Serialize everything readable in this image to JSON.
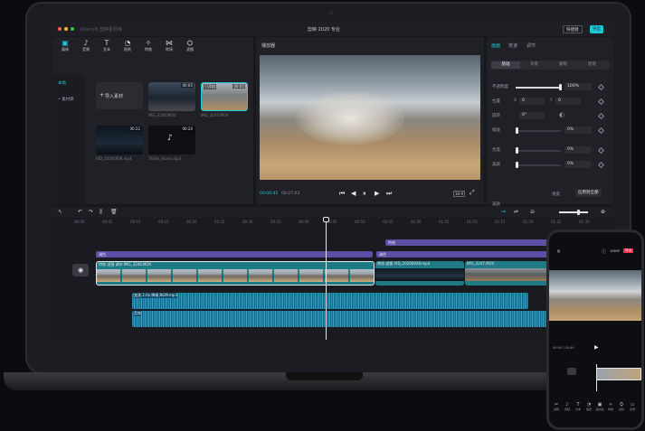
{
  "app": {
    "window_title": "剪映 2020 专业",
    "project_path": "/Users/6 剪映素材库",
    "fullscreen_label": "快捷键",
    "export_label": "导出"
  },
  "toolbar": {
    "tools": [
      {
        "icon": "media-icon",
        "glyph": "▣",
        "label": "媒体"
      },
      {
        "icon": "audio-icon",
        "glyph": "♪",
        "label": "音频"
      },
      {
        "icon": "text-icon",
        "glyph": "T",
        "label": "文本"
      },
      {
        "icon": "sticker-icon",
        "glyph": "◔",
        "label": "贴纸"
      },
      {
        "icon": "effects-icon",
        "glyph": "✧",
        "label": "特效"
      },
      {
        "icon": "transition-icon",
        "glyph": "⋈",
        "label": "转场"
      },
      {
        "icon": "filter-icon",
        "glyph": "⛭",
        "label": "滤镜"
      }
    ]
  },
  "media_sidebar": {
    "items": [
      {
        "label": "本地"
      },
      {
        "label": "• 素材库"
      }
    ]
  },
  "media_grid": {
    "import_label": "导入素材",
    "clips": [
      {
        "duration": "00:05",
        "name": "IMG_3246.MOV",
        "badge": ""
      },
      {
        "duration": "00:05",
        "name": "IMG_3247.MOV",
        "badge": "已添加"
      },
      {
        "duration": "00:22",
        "name": "VID_20200928.mp4",
        "badge": ""
      },
      {
        "duration": "00:20",
        "name": "TikTok_music.mp3",
        "badge": ""
      }
    ]
  },
  "player": {
    "title": "播放器",
    "current_time": "00:00:45",
    "total_time": "00:27:03",
    "ratio_label": "16:9"
  },
  "properties": {
    "tabs": [
      "画面",
      "变速",
      "调节"
    ],
    "subtabs": [
      "基础",
      "背景",
      "蒙版",
      "智能"
    ],
    "rows": [
      {
        "label": "不透明度",
        "value": "100%"
      },
      {
        "label": "位置",
        "x": "0",
        "y": "0"
      },
      {
        "label": "旋转",
        "value": "0°"
      },
      {
        "label": "缩放",
        "value": "0%"
      },
      {
        "label": "亮度",
        "value": "0%"
      },
      {
        "label": "美颜",
        "value": "0%"
      },
      {
        "label": "美颜",
        "value": ""
      }
    ],
    "reset_label": "重置",
    "apply_all_label": "应用到全部"
  },
  "timeline": {
    "ticks": [
      "00:00",
      "00:05",
      "00:10",
      "00:15",
      "00:20",
      "00:25",
      "00:30",
      "00:35",
      "00:40",
      "00:45",
      "00:50",
      "00:55",
      "01:00",
      "01:05",
      "01:10",
      "01:15",
      "01:20",
      "01:25",
      "01:30"
    ],
    "effect_tracks": [
      {
        "label": "特效"
      },
      {
        "label": "调色"
      },
      {
        "label": "调色"
      }
    ],
    "main_clip": {
      "labels": [
        "特效",
        "滤镜",
        "调节",
        "IMG_3246.MOV"
      ]
    },
    "second_clip": {
      "labels": [
        "转场",
        "滤镜",
        "VID_20200928.mp4"
      ]
    },
    "third_clip": {
      "labels": [
        "IMG_3247.MOV"
      ]
    },
    "audio_tracks": [
      {
        "label": "变速 2.0x  降噪  BGM.mp3"
      },
      {
        "label": "音效"
      }
    ]
  },
  "phone": {
    "export_label": "导出",
    "resolution_label": "1080P",
    "time_label": "00:00 / 00:40",
    "bottom_tools": [
      "剪辑",
      "音频",
      "文本",
      "贴纸",
      "画中画",
      "特效",
      "滤镜",
      "比例"
    ]
  },
  "colors": {
    "accent": "#1ec8d8",
    "purple_track": "#5b4fa6",
    "teal_clip": "#1e7a84",
    "audio": "#2f8fb0"
  }
}
